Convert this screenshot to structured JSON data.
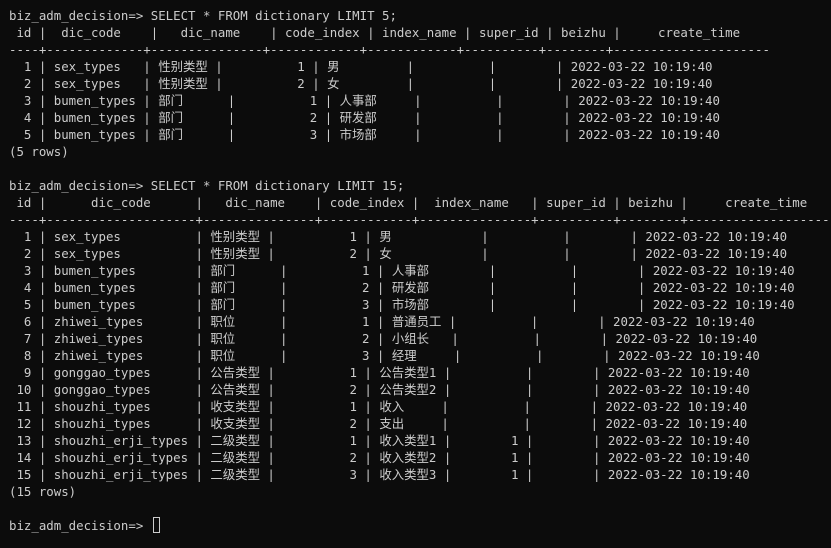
{
  "terminal": {
    "colors": {
      "background": "#0c0c0c",
      "foreground": "#cccccc"
    },
    "query1": {
      "prompt": "biz_adm_decision=> SELECT * FROM dictionary LIMIT 5;",
      "header": " id |  dic_code    |   dic_name    | code_index | index_name | super_id | beizhu |     create_time",
      "separator": "----+-------------+---------------+------------+------------+----------+--------+---------------------",
      "rows": [
        "  1 | sex_types   | 性别类型 |          1 | 男         |          |        | 2022-03-22 10:19:40",
        "  2 | sex_types   | 性别类型 |          2 | 女         |          |        | 2022-03-22 10:19:40",
        "  3 | bumen_types | 部门      |          1 | 人事部     |          |        | 2022-03-22 10:19:40",
        "  4 | bumen_types | 部门      |          2 | 研发部     |          |        | 2022-03-22 10:19:40",
        "  5 | bumen_types | 部门      |          3 | 市场部     |          |        | 2022-03-22 10:19:40"
      ],
      "footer": "(5 rows)"
    },
    "query2": {
      "prompt": "biz_adm_decision=> SELECT * FROM dictionary LIMIT 15;",
      "header": " id |      dic_code      |   dic_name    | code_index |  index_name   | super_id | beizhu |     create_time",
      "separator": "----+--------------------+---------------+------------+---------------+----------+--------+---------------------",
      "rows": [
        "  1 | sex_types          | 性别类型 |          1 | 男            |          |        | 2022-03-22 10:19:40",
        "  2 | sex_types          | 性别类型 |          2 | 女            |          |        | 2022-03-22 10:19:40",
        "  3 | bumen_types        | 部门      |          1 | 人事部        |          |        | 2022-03-22 10:19:40",
        "  4 | bumen_types        | 部门      |          2 | 研发部        |          |        | 2022-03-22 10:19:40",
        "  5 | bumen_types        | 部门      |          3 | 市场部        |          |        | 2022-03-22 10:19:40",
        "  6 | zhiwei_types       | 职位      |          1 | 普通员工 |          |        | 2022-03-22 10:19:40",
        "  7 | zhiwei_types       | 职位      |          2 | 小组长   |          |        | 2022-03-22 10:19:40",
        "  8 | zhiwei_types       | 职位      |          3 | 经理     |          |        | 2022-03-22 10:19:40",
        "  9 | gonggao_types      | 公告类型 |          1 | 公告类型1 |          |        | 2022-03-22 10:19:40",
        " 10 | gonggao_types      | 公告类型 |          2 | 公告类型2 |          |        | 2022-03-22 10:19:40",
        " 11 | shouzhi_types      | 收支类型 |          1 | 收入     |          |        | 2022-03-22 10:19:40",
        " 12 | shouzhi_types      | 收支类型 |          2 | 支出     |          |        | 2022-03-22 10:19:40",
        " 13 | shouzhi_erji_types | 二级类型 |          1 | 收入类型1 |        1 |        | 2022-03-22 10:19:40",
        " 14 | shouzhi_erji_types | 二级类型 |          2 | 收入类型2 |        1 |        | 2022-03-22 10:19:40",
        " 15 | shouzhi_erji_types | 二级类型 |          3 | 收入类型3 |        1 |        | 2022-03-22 10:19:40"
      ],
      "footer": "(15 rows)"
    },
    "final_prompt": "biz_adm_decision=> "
  }
}
